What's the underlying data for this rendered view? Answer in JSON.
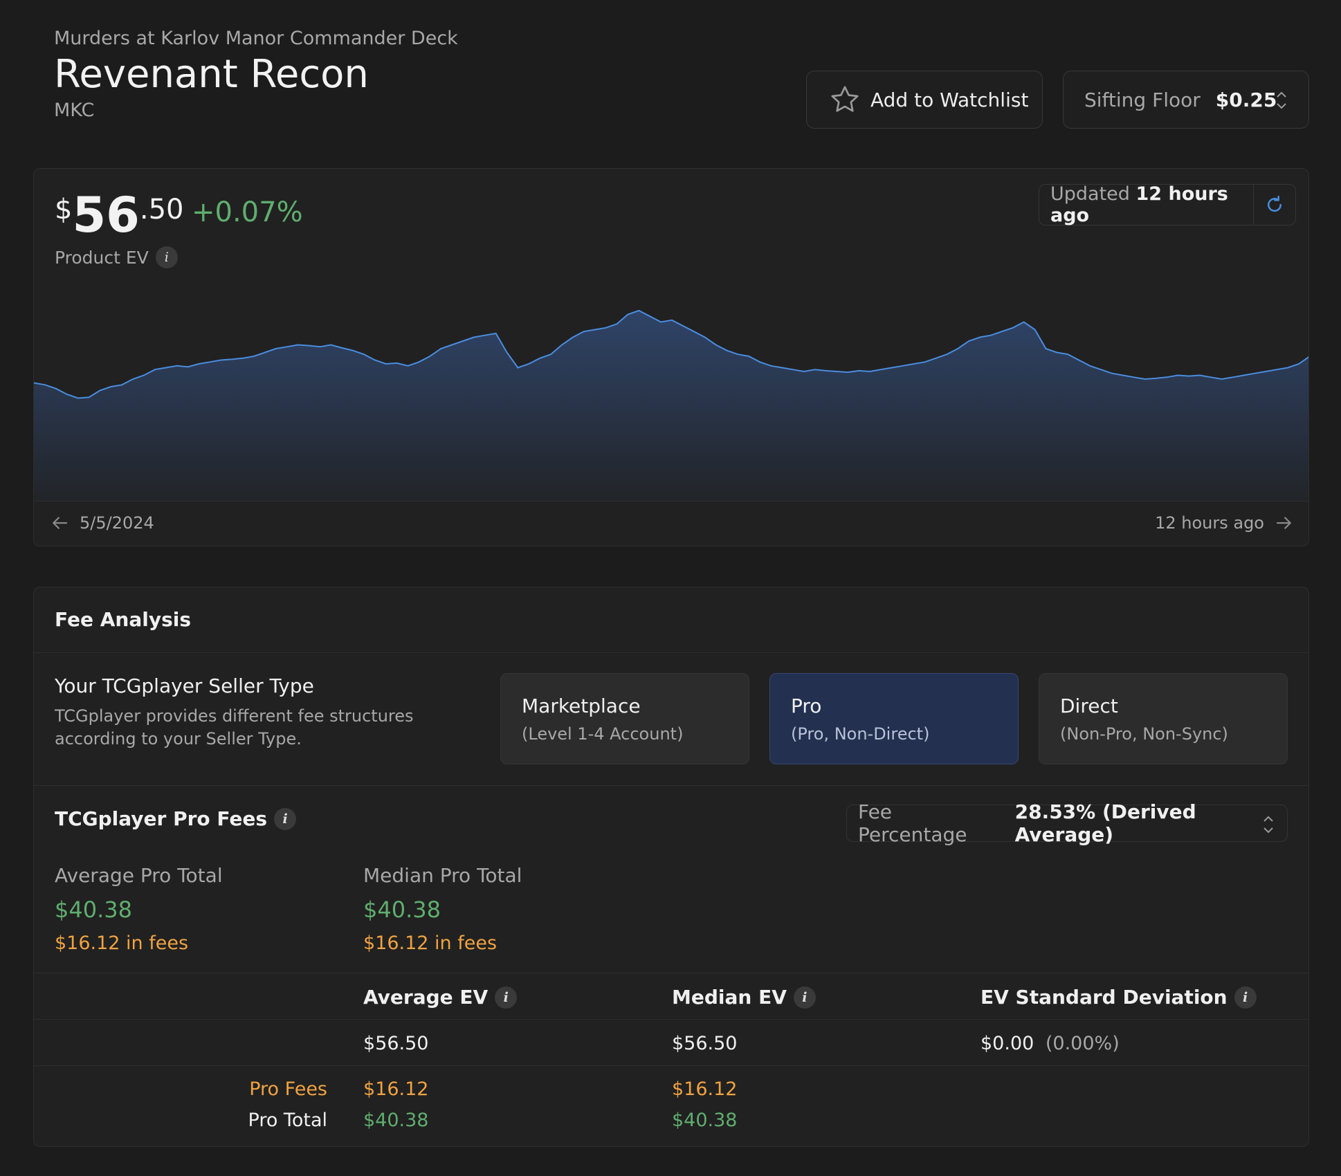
{
  "header": {
    "set_name": "Murders at Karlov Manor Commander Deck",
    "product_name": "Revenant Recon",
    "set_code": "MKC"
  },
  "watchlist": {
    "label": "Add to Watchlist",
    "icon": "star-icon"
  },
  "sifting_floor": {
    "label": "Sifting Floor",
    "value": "$0.25"
  },
  "price": {
    "currency": "$",
    "dollars": "56",
    "cents": ".50",
    "change": "+0.07%",
    "label": "Product EV"
  },
  "updated": {
    "prefix": "Updated",
    "time": "12 hours ago"
  },
  "chart": {
    "start_label": "5/5/2024",
    "end_label": "12 hours ago",
    "line_color": "#4a8de0",
    "values": [
      57.1,
      57.05,
      56.95,
      56.8,
      56.7,
      56.72,
      56.9,
      57.0,
      57.05,
      57.2,
      57.3,
      57.45,
      57.5,
      57.55,
      57.52,
      57.6,
      57.65,
      57.7,
      57.72,
      57.75,
      57.8,
      57.9,
      58.0,
      58.05,
      58.1,
      58.08,
      58.05,
      58.1,
      58.02,
      57.95,
      57.85,
      57.7,
      57.6,
      57.62,
      57.55,
      57.65,
      57.8,
      58.0,
      58.1,
      58.2,
      58.3,
      58.35,
      58.4,
      57.9,
      57.5,
      57.6,
      57.75,
      57.85,
      58.1,
      58.3,
      58.45,
      58.5,
      58.55,
      58.65,
      58.9,
      59.0,
      58.85,
      58.7,
      58.75,
      58.6,
      58.45,
      58.3,
      58.1,
      57.95,
      57.85,
      57.8,
      57.65,
      57.55,
      57.5,
      57.45,
      57.4,
      57.45,
      57.42,
      57.4,
      57.38,
      57.42,
      57.4,
      57.45,
      57.5,
      57.55,
      57.6,
      57.65,
      57.75,
      57.85,
      58.0,
      58.2,
      58.3,
      58.35,
      58.45,
      58.55,
      58.7,
      58.5,
      58.0,
      57.9,
      57.85,
      57.7,
      57.55,
      57.45,
      57.35,
      57.3,
      57.25,
      57.2,
      57.22,
      57.25,
      57.3,
      57.28,
      57.3,
      57.25,
      57.2,
      57.25,
      57.3,
      57.35,
      57.4,
      57.45,
      57.5,
      57.6,
      57.8
    ],
    "ylim": [
      54,
      60
    ]
  },
  "fee_analysis": {
    "title": "Fee Analysis",
    "seller_type_title": "Your TCGplayer Seller Type",
    "seller_type_desc": "TCGplayer provides different fee structures according to your Seller Type.",
    "seller_types": [
      {
        "title": "Marketplace",
        "subtitle": "(Level 1-4 Account)"
      },
      {
        "title": "Pro",
        "subtitle": "(Pro, Non-Direct)"
      },
      {
        "title": "Direct",
        "subtitle": "(Non-Pro, Non-Sync)"
      }
    ],
    "pro_fees_title": "TCGplayer Pro Fees",
    "fee_percentage_label": "Fee Percentage",
    "fee_percentage_value": "28.53% (Derived Average)",
    "avg_total": {
      "label": "Average Pro Total",
      "amount": "$40.38",
      "fees": "$16.12 in fees"
    },
    "median_total": {
      "label": "Median Pro Total",
      "amount": "$40.38",
      "fees": "$16.12 in fees"
    },
    "table": {
      "headers": [
        "Average EV",
        "Median EV",
        "EV Standard Deviation"
      ],
      "ev_row": [
        "$56.50",
        "$56.50",
        "$0.00"
      ],
      "stdev_pct": "(0.00%)",
      "pro_fees_label": "Pro Fees",
      "pro_fees": [
        "$16.12",
        "$16.12"
      ],
      "pro_total_label": "Pro Total",
      "pro_total": [
        "$40.38",
        "$40.38"
      ]
    }
  }
}
